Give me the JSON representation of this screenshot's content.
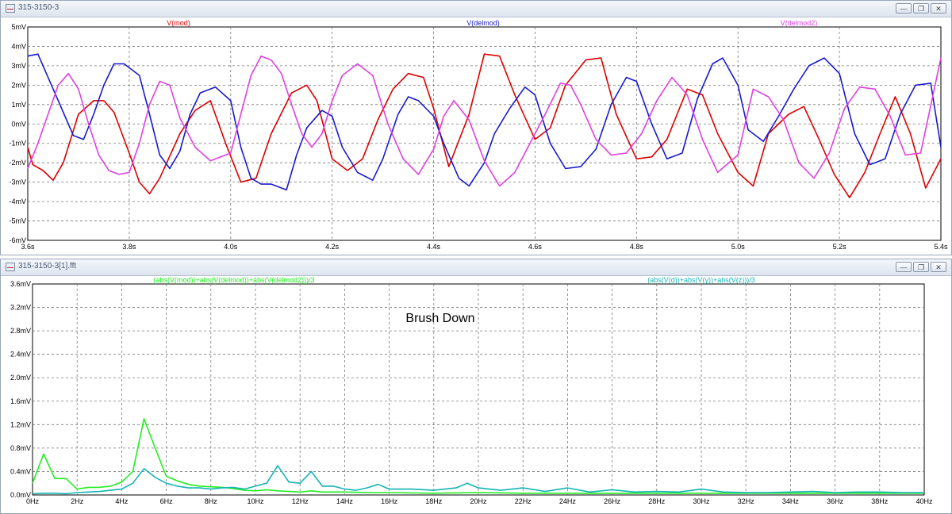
{
  "windows": [
    {
      "title": "315-3150-3",
      "buttons": [
        "minimize",
        "restore",
        "close"
      ]
    },
    {
      "title": "315-3150-3[1].fft",
      "buttons": [
        "minimize",
        "restore",
        "close"
      ]
    }
  ],
  "chart_data": [
    {
      "type": "line",
      "xlabel": "",
      "ylabel": "",
      "xlim": [
        3.6,
        5.4
      ],
      "ylim": [
        -6,
        5
      ],
      "x_unit": "s",
      "y_unit": "mV",
      "x_ticks": [
        "3.6s",
        "3.8s",
        "4.0s",
        "4.2s",
        "4.4s",
        "4.6s",
        "4.8s",
        "5.0s",
        "5.2s",
        "5.4s"
      ],
      "y_ticks": [
        "5mV",
        "4mV",
        "3mV",
        "2mV",
        "1mV",
        "0mV",
        "-1mV",
        "-2mV",
        "-3mV",
        "-4mV",
        "-5mV",
        "-6mV"
      ],
      "grid": true,
      "legend": "top",
      "series": [
        {
          "name": "V(mod)",
          "color": "#dd0000",
          "x": [
            3.6,
            3.61,
            3.63,
            3.65,
            3.67,
            3.7,
            3.73,
            3.75,
            3.77,
            3.8,
            3.82,
            3.84,
            3.86,
            3.9,
            3.93,
            3.96,
            3.99,
            4.02,
            4.05,
            4.08,
            4.12,
            4.15,
            4.17,
            4.2,
            4.23,
            4.26,
            4.29,
            4.32,
            4.35,
            4.38,
            4.4,
            4.43,
            4.47,
            4.5,
            4.53,
            4.56,
            4.6,
            4.63,
            4.66,
            4.7,
            4.73,
            4.76,
            4.8,
            4.83,
            4.86,
            4.9,
            4.93,
            4.96,
            5.0,
            5.03,
            5.06,
            5.1,
            5.13,
            5.16,
            5.19,
            5.22,
            5.25,
            5.28,
            5.31,
            5.34,
            5.37,
            5.4
          ],
          "y": [
            -1.2,
            -2.1,
            -2.4,
            -2.9,
            -2.0,
            0.5,
            1.2,
            1.2,
            0.6,
            -1.5,
            -3.0,
            -3.6,
            -2.8,
            -0.5,
            0.7,
            1.2,
            -1.0,
            -3.0,
            -2.8,
            -0.5,
            1.6,
            2.0,
            1.2,
            -1.8,
            -2.4,
            -1.8,
            0.2,
            1.8,
            2.6,
            2.4,
            0.8,
            -2.2,
            0.5,
            3.6,
            3.5,
            1.5,
            -0.8,
            -0.2,
            2.0,
            3.3,
            3.4,
            0.5,
            -1.8,
            -1.7,
            -0.8,
            1.8,
            1.5,
            -0.5,
            -2.5,
            -3.2,
            -0.5,
            0.5,
            0.9,
            -0.8,
            -2.6,
            -3.8,
            -2.5,
            -0.5,
            1.4,
            -0.5,
            -3.3,
            -1.8
          ]
        },
        {
          "name": "V(delmod)",
          "color": "#1a1acc",
          "x": [
            3.6,
            3.62,
            3.64,
            3.66,
            3.69,
            3.71,
            3.73,
            3.75,
            3.77,
            3.79,
            3.82,
            3.84,
            3.86,
            3.88,
            3.9,
            3.92,
            3.94,
            3.97,
            4.0,
            4.02,
            4.04,
            4.06,
            4.08,
            4.11,
            4.13,
            4.15,
            4.18,
            4.2,
            4.22,
            4.25,
            4.28,
            4.3,
            4.33,
            4.35,
            4.37,
            4.4,
            4.42,
            4.45,
            4.47,
            4.5,
            4.52,
            4.55,
            4.58,
            4.6,
            4.63,
            4.66,
            4.69,
            4.72,
            4.75,
            4.78,
            4.8,
            4.83,
            4.86,
            4.89,
            4.92,
            4.95,
            4.97,
            5.0,
            5.02,
            5.05,
            5.08,
            5.11,
            5.14,
            5.17,
            5.2,
            5.23,
            5.26,
            5.29,
            5.32,
            5.35,
            5.38,
            5.4
          ],
          "y": [
            3.5,
            3.6,
            2.4,
            1.2,
            -0.6,
            -0.8,
            0.5,
            2.0,
            3.1,
            3.1,
            2.5,
            0.5,
            -1.6,
            -2.3,
            -1.4,
            0.5,
            1.6,
            1.9,
            1.2,
            -1.2,
            -2.8,
            -3.1,
            -3.1,
            -3.4,
            -1.6,
            -0.2,
            0.7,
            0.4,
            -1.2,
            -2.5,
            -2.9,
            -1.8,
            0.5,
            1.4,
            1.2,
            0.4,
            -1.0,
            -2.8,
            -3.2,
            -2.0,
            -0.5,
            0.8,
            1.9,
            1.5,
            -1.0,
            -2.3,
            -2.2,
            -1.3,
            1.0,
            2.4,
            2.2,
            0.0,
            -1.8,
            -1.5,
            1.3,
            3.1,
            3.4,
            2.0,
            -0.3,
            -0.9,
            0.4,
            1.8,
            3.0,
            3.4,
            2.6,
            -0.5,
            -2.1,
            -1.8,
            0.5,
            2.0,
            2.1,
            -1.2
          ]
        },
        {
          "name": "V(delmod2)",
          "color": "#e040e0",
          "x": [
            3.6,
            3.62,
            3.64,
            3.66,
            3.68,
            3.7,
            3.72,
            3.74,
            3.76,
            3.78,
            3.8,
            3.82,
            3.84,
            3.86,
            3.88,
            3.9,
            3.93,
            3.96,
            4.0,
            4.02,
            4.04,
            4.06,
            4.08,
            4.1,
            4.12,
            4.14,
            4.16,
            4.18,
            4.2,
            4.22,
            4.25,
            4.28,
            4.31,
            4.34,
            4.37,
            4.4,
            4.42,
            4.44,
            4.47,
            4.5,
            4.53,
            4.56,
            4.59,
            4.62,
            4.65,
            4.67,
            4.69,
            4.72,
            4.75,
            4.78,
            4.81,
            4.84,
            4.87,
            4.9,
            4.93,
            4.96,
            5.0,
            5.03,
            5.06,
            5.09,
            5.12,
            5.15,
            5.18,
            5.21,
            5.24,
            5.27,
            5.3,
            5.33,
            5.36,
            5.4
          ],
          "y": [
            -2.3,
            -1.0,
            0.5,
            2.0,
            2.6,
            1.8,
            0.0,
            -1.6,
            -2.4,
            -2.6,
            -2.5,
            -1.0,
            1.0,
            2.2,
            2.0,
            0.3,
            -1.2,
            -1.9,
            -1.5,
            0.5,
            2.5,
            3.5,
            3.3,
            2.6,
            1.0,
            -0.5,
            -1.2,
            -0.5,
            1.2,
            2.5,
            3.1,
            2.5,
            0.0,
            -1.8,
            -2.6,
            -1.3,
            0.4,
            1.2,
            0.2,
            -1.9,
            -3.2,
            -2.5,
            -1.0,
            0.5,
            2.1,
            2.0,
            1.0,
            -0.8,
            -1.6,
            -1.5,
            -0.5,
            1.2,
            2.4,
            1.5,
            -0.8,
            -2.5,
            -1.6,
            1.8,
            1.4,
            0.2,
            -2.0,
            -2.8,
            -1.5,
            0.8,
            1.9,
            1.8,
            0.4,
            -1.6,
            -1.5,
            3.4
          ]
        }
      ]
    },
    {
      "type": "line",
      "xlabel": "",
      "ylabel": "",
      "xlim": [
        0,
        40
      ],
      "ylim": [
        0,
        3.6
      ],
      "x_unit": "Hz",
      "y_unit": "mV",
      "x_ticks": [
        "0Hz",
        "2Hz",
        "4Hz",
        "6Hz",
        "8Hz",
        "10Hz",
        "12Hz",
        "14Hz",
        "16Hz",
        "18Hz",
        "20Hz",
        "22Hz",
        "24Hz",
        "26Hz",
        "28Hz",
        "30Hz",
        "32Hz",
        "34Hz",
        "36Hz",
        "38Hz",
        "40Hz"
      ],
      "y_ticks": [
        "3.6mV",
        "3.2mV",
        "2.8mV",
        "2.4mV",
        "2.0mV",
        "1.6mV",
        "1.2mV",
        "0.8mV",
        "0.4mV",
        "0.0mV"
      ],
      "grid": true,
      "legend": "top",
      "annotation": "Brush Down",
      "series": [
        {
          "name": "(abs(V(mod))+abs(V(delmod))+abs(V(delmod2)))/3",
          "color": "#22ee22",
          "x": [
            0,
            0.5,
            1,
            1.5,
            2,
            2.5,
            3,
            3.5,
            4,
            4.5,
            5,
            5.5,
            6,
            6.5,
            7,
            7.5,
            8,
            8.5,
            9,
            9.5,
            10,
            10.5,
            11,
            11.5,
            12,
            12.5,
            13,
            14,
            15,
            16,
            18,
            20,
            22,
            24,
            26,
            28,
            30,
            32,
            34,
            36,
            38,
            40
          ],
          "y": [
            0.2,
            0.7,
            0.28,
            0.28,
            0.1,
            0.13,
            0.13,
            0.15,
            0.22,
            0.4,
            1.3,
            0.8,
            0.32,
            0.24,
            0.18,
            0.15,
            0.14,
            0.13,
            0.11,
            0.08,
            0.07,
            0.09,
            0.07,
            0.06,
            0.05,
            0.07,
            0.05,
            0.05,
            0.04,
            0.04,
            0.03,
            0.04,
            0.03,
            0.03,
            0.03,
            0.03,
            0.03,
            0.03,
            0.03,
            0.03,
            0.03,
            0.03
          ]
        },
        {
          "name": "(abs(V(d))+abs(V(y))+abs(V(z)))/3",
          "color": "#14b4b4",
          "x": [
            0,
            0.5,
            1,
            1.5,
            2,
            2.5,
            3,
            3.5,
            4,
            4.5,
            5,
            5.5,
            6,
            6.5,
            7,
            7.5,
            8,
            8.5,
            9,
            9.5,
            10,
            10.5,
            11,
            11.5,
            12,
            12.5,
            13,
            13.5,
            14,
            14.5,
            15,
            15.5,
            16,
            17,
            18,
            19,
            19.5,
            20,
            21,
            22,
            23,
            24,
            25,
            26,
            27,
            28,
            29,
            30,
            31,
            32,
            33,
            34,
            35,
            36,
            37,
            38,
            39,
            40
          ],
          "y": [
            0.02,
            0.03,
            0.03,
            0.02,
            0.04,
            0.05,
            0.06,
            0.08,
            0.1,
            0.2,
            0.45,
            0.3,
            0.2,
            0.15,
            0.12,
            0.12,
            0.1,
            0.12,
            0.13,
            0.1,
            0.15,
            0.2,
            0.5,
            0.22,
            0.2,
            0.4,
            0.15,
            0.15,
            0.1,
            0.08,
            0.12,
            0.18,
            0.1,
            0.1,
            0.08,
            0.12,
            0.2,
            0.12,
            0.08,
            0.12,
            0.06,
            0.12,
            0.05,
            0.09,
            0.05,
            0.06,
            0.05,
            0.1,
            0.05,
            0.04,
            0.04,
            0.05,
            0.06,
            0.04,
            0.05,
            0.05,
            0.04,
            0.04
          ]
        }
      ]
    }
  ]
}
